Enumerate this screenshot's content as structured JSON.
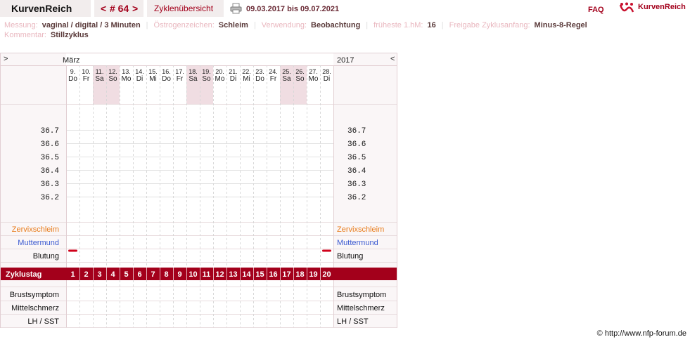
{
  "app": {
    "brand_title": "KurvenReich",
    "nav_prev": "<",
    "cycle_label": "# 64",
    "nav_next": ">",
    "overview_label": "Zyklenübersicht",
    "date_range": "09.03.2017 bis 09.07.2021",
    "faq_label": "FAQ",
    "logo_text": "KurvenReich"
  },
  "info": [
    {
      "label": "Messung:",
      "value": "vaginal / digital / 3 Minuten"
    },
    {
      "label": "Östrogenzeichen:",
      "value": "Schleim"
    },
    {
      "label": "Verwendung:",
      "value": "Beobachtung"
    },
    {
      "label": "früheste 1.hM:",
      "value": "16"
    },
    {
      "label": "Freigabe Zyklusanfang:",
      "value": "Minus-8-Regel"
    }
  ],
  "comment": {
    "label": "Kommentar:",
    "value": "Stillzyklus"
  },
  "chart": {
    "scroll_left": ">",
    "scroll_right": "<",
    "month": "März",
    "year": "2017",
    "days": [
      {
        "date": "9.",
        "wd": "Do",
        "we": false
      },
      {
        "date": "10.",
        "wd": "Fr",
        "we": false
      },
      {
        "date": "11.",
        "wd": "Sa",
        "we": true
      },
      {
        "date": "12.",
        "wd": "So",
        "we": true
      },
      {
        "date": "13.",
        "wd": "Mo",
        "we": false
      },
      {
        "date": "14.",
        "wd": "Di",
        "we": false
      },
      {
        "date": "15.",
        "wd": "Mi",
        "we": false
      },
      {
        "date": "16.",
        "wd": "Do",
        "we": false
      },
      {
        "date": "17.",
        "wd": "Fr",
        "we": false
      },
      {
        "date": "18.",
        "wd": "Sa",
        "we": true
      },
      {
        "date": "19.",
        "wd": "So",
        "we": true
      },
      {
        "date": "20.",
        "wd": "Mo",
        "we": false
      },
      {
        "date": "21.",
        "wd": "Di",
        "we": false
      },
      {
        "date": "22.",
        "wd": "Mi",
        "we": false
      },
      {
        "date": "23.",
        "wd": "Do",
        "we": false
      },
      {
        "date": "24.",
        "wd": "Fr",
        "we": false
      },
      {
        "date": "25.",
        "wd": "Sa",
        "we": true
      },
      {
        "date": "26.",
        "wd": "So",
        "we": true
      },
      {
        "date": "27.",
        "wd": "Mo",
        "we": false
      },
      {
        "date": "28.",
        "wd": "Di",
        "we": false
      }
    ],
    "temps": [
      "36.7",
      "36.6",
      "36.5",
      "36.4",
      "36.3",
      "36.2"
    ],
    "cervix_label": "Zervixschleim",
    "os_label": "Muttermund",
    "bleeding_label": "Blutung",
    "bleeding_days": [
      1,
      20
    ],
    "cycle_day_label": "Zyklustag",
    "cycle_days": [
      "1",
      "2",
      "3",
      "4",
      "5",
      "6",
      "7",
      "8",
      "9",
      "10",
      "11",
      "12",
      "13",
      "14",
      "15",
      "16",
      "17",
      "18",
      "19",
      "20"
    ],
    "breast_label": "Brustsymptom",
    "pain_label": "Mittelschmerz",
    "lh_label": "LH / SST",
    "colors": {
      "accent": "#a3001b",
      "cervix": "#e87b1a",
      "os": "#3b5ad1",
      "weekend": "#f0dde2"
    }
  },
  "footer": {
    "copyright": "© http://www.nfp-forum.de"
  }
}
